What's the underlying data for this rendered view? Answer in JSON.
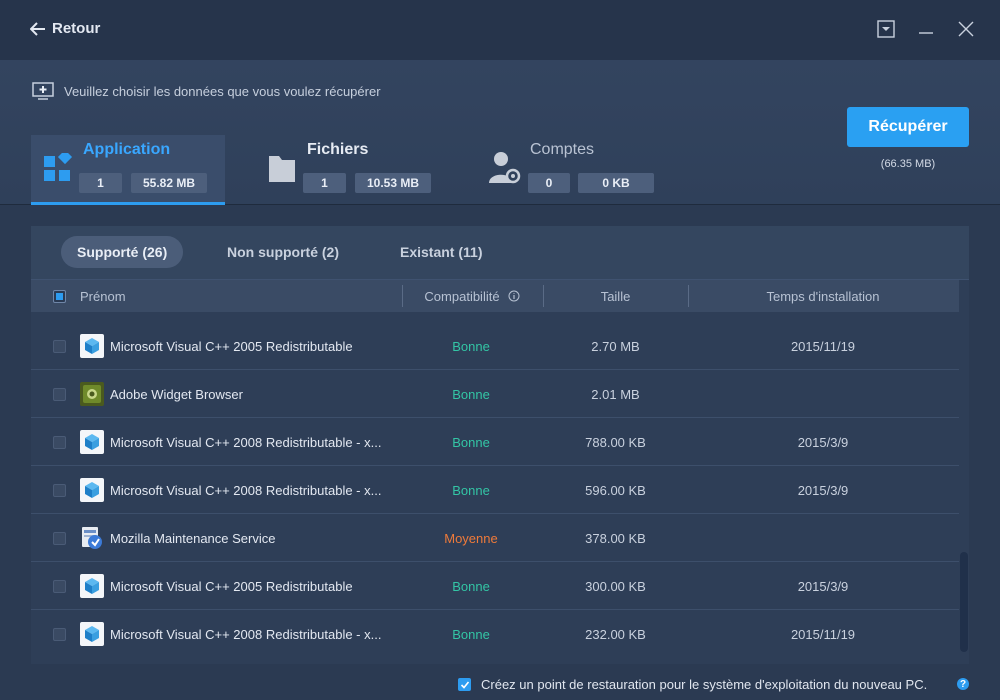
{
  "window": {
    "back_label": "Retour"
  },
  "header": {
    "hint": "Veuillez choisir les données que vous voulez récupérer",
    "recover_button": "Récupérer",
    "recover_size": "(66.35 MB)",
    "tabs": [
      {
        "label": "Application",
        "count": "1",
        "size": "55.82 MB",
        "icon": "apps-grid-icon"
      },
      {
        "label": "Fichiers",
        "count": "1",
        "size": "10.53 MB",
        "icon": "folder-icon"
      },
      {
        "label": "Comptes",
        "count": "0",
        "size": "0 KB",
        "icon": "user-settings-icon"
      }
    ]
  },
  "subtabs": [
    {
      "label": "Supporté (26)",
      "active": true
    },
    {
      "label": "Non supporté (2)",
      "active": false
    },
    {
      "label": "Existant (11)",
      "active": false
    }
  ],
  "table": {
    "columns": {
      "name": "Prénom",
      "compat": "Compatibilité",
      "size": "Taille",
      "date": "Temps d'installation"
    },
    "rows": [
      {
        "name": "Microsoft Visual C++ 2005 Redistributable",
        "compat": "Bonne",
        "size": "2.70 MB",
        "date": "2015/11/19",
        "icon": "cube-icon"
      },
      {
        "name": "Adobe Widget Browser",
        "compat": "Bonne",
        "size": "2.01 MB",
        "date": "",
        "icon": "adobe-widget-icon"
      },
      {
        "name": "Microsoft Visual C++ 2008 Redistributable - x...",
        "compat": "Bonne",
        "size": "788.00 KB",
        "date": "2015/3/9",
        "icon": "cube-icon"
      },
      {
        "name": "Microsoft Visual C++ 2008 Redistributable - x...",
        "compat": "Bonne",
        "size": "596.00 KB",
        "date": "2015/3/9",
        "icon": "cube-icon"
      },
      {
        "name": "Mozilla Maintenance Service",
        "compat": "Moyenne",
        "size": "378.00 KB",
        "date": "",
        "icon": "installer-icon"
      },
      {
        "name": "Microsoft Visual C++ 2005 Redistributable",
        "compat": "Bonne",
        "size": "300.00 KB",
        "date": "2015/3/9",
        "icon": "cube-icon"
      },
      {
        "name": "Microsoft Visual C++ 2008 Redistributable - x...",
        "compat": "Bonne",
        "size": "232.00 KB",
        "date": "2015/11/19",
        "icon": "cube-icon"
      }
    ]
  },
  "footer": {
    "restore_point_label": "Créez un point de restauration pour le système d'exploitation du nouveau PC.",
    "help": "?"
  },
  "colors": {
    "accent": "#2d9cf0",
    "good": "#33c5a5",
    "medium": "#ee7a3a"
  }
}
